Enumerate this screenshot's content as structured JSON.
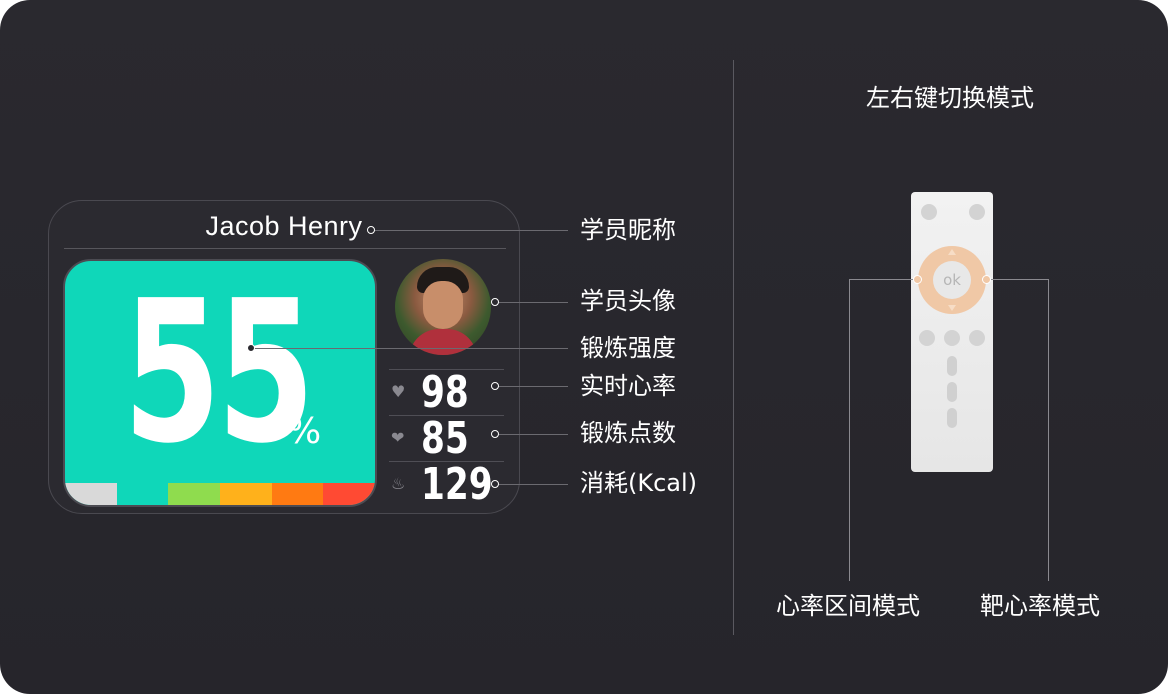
{
  "card": {
    "name": "Jacob Henry",
    "intensity": "55",
    "intensity_unit": "%",
    "zone_bar": [
      {
        "color": "#d9d9d9",
        "weight": 1
      },
      {
        "color": "#0fd7b9",
        "weight": 1
      },
      {
        "color": "#8fdc4e",
        "weight": 1
      },
      {
        "color": "#ffb11b",
        "weight": 1
      },
      {
        "color": "#ff7a12",
        "weight": 1
      },
      {
        "color": "#ff4a33",
        "weight": 1
      }
    ],
    "stats": [
      {
        "icon": "heart-icon",
        "value": "98"
      },
      {
        "icon": "points-icon",
        "value": "85"
      },
      {
        "icon": "flame-icon",
        "value": "129"
      }
    ]
  },
  "labels": {
    "nickname": "学员昵称",
    "avatar": "学员头像",
    "intensity": "锻炼强度",
    "heart_rate": "实时心率",
    "points": "锻炼点数",
    "calories": "消耗(Kcal)"
  },
  "remote": {
    "title": "左右键切换模式",
    "ok_label": "ok",
    "left_mode": "心率区间模式",
    "right_mode": "靶心率模式"
  },
  "colors": {
    "background": "#2a292f",
    "accent": "#0fd7b9",
    "remote_ring": "#f0c8a6"
  }
}
